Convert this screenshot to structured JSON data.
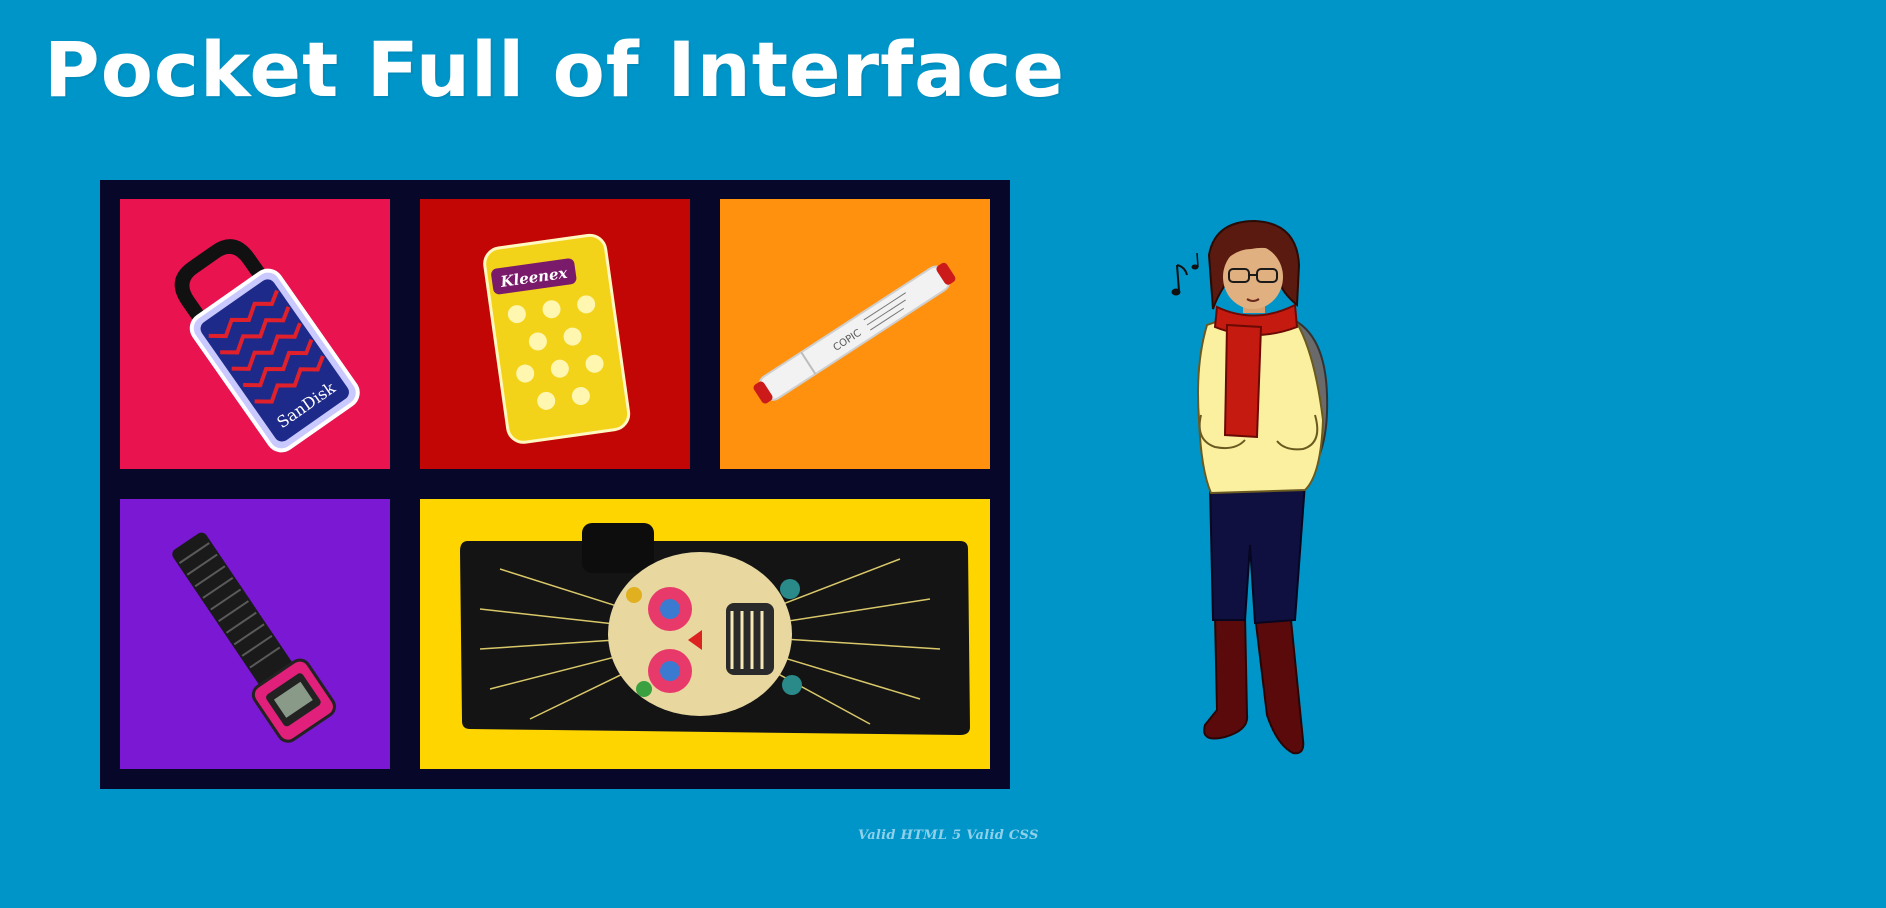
{
  "header": {
    "title": "Pocket Full of Interface"
  },
  "items": [
    {
      "name": "usb-drive",
      "brand": "SanDisk",
      "bg": "#e8134f"
    },
    {
      "name": "tissue-pack",
      "brand": "Kleenex",
      "bg": "#c20505"
    },
    {
      "name": "marker",
      "brand": "COPIC",
      "bg": "#ff910e"
    },
    {
      "name": "wristwatch",
      "bg": "#7a18d4"
    },
    {
      "name": "wallet",
      "bg": "#ffd500"
    }
  ],
  "footer": {
    "html_link": "Valid HTML 5",
    "css_link": "Valid CSS"
  }
}
